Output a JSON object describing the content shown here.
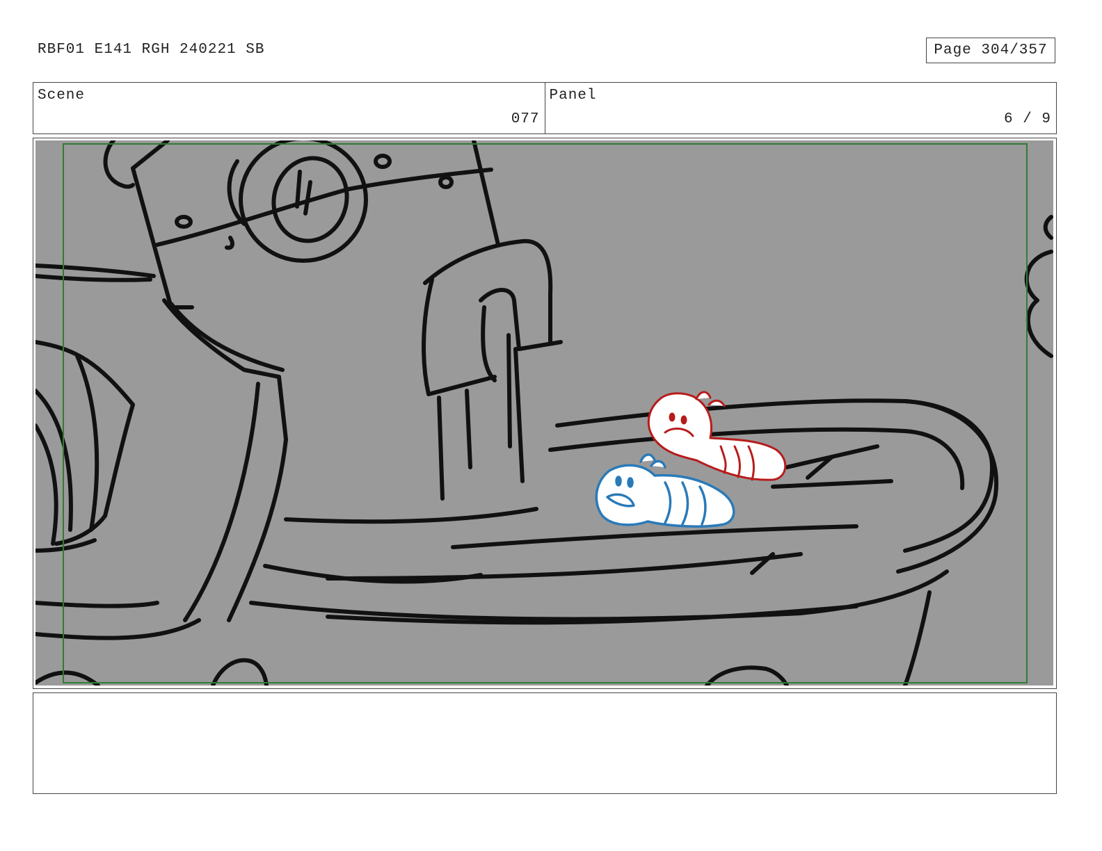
{
  "header": {
    "doc_title": "RBF01 E141 RGH 240221 SB",
    "page_label": "Page 304/357"
  },
  "info": {
    "scene_label": "Scene",
    "scene_value": "077",
    "panel_label": "Panel",
    "panel_value": "6 / 9"
  },
  "frame": {
    "background_color": "#9a9a9a",
    "safe_area_color": "#2e7d32",
    "line_color": "#111111",
    "worm_red_color": "#b71c1c",
    "worm_blue_color": "#2a7ab8"
  },
  "notes": {
    "text": ""
  }
}
